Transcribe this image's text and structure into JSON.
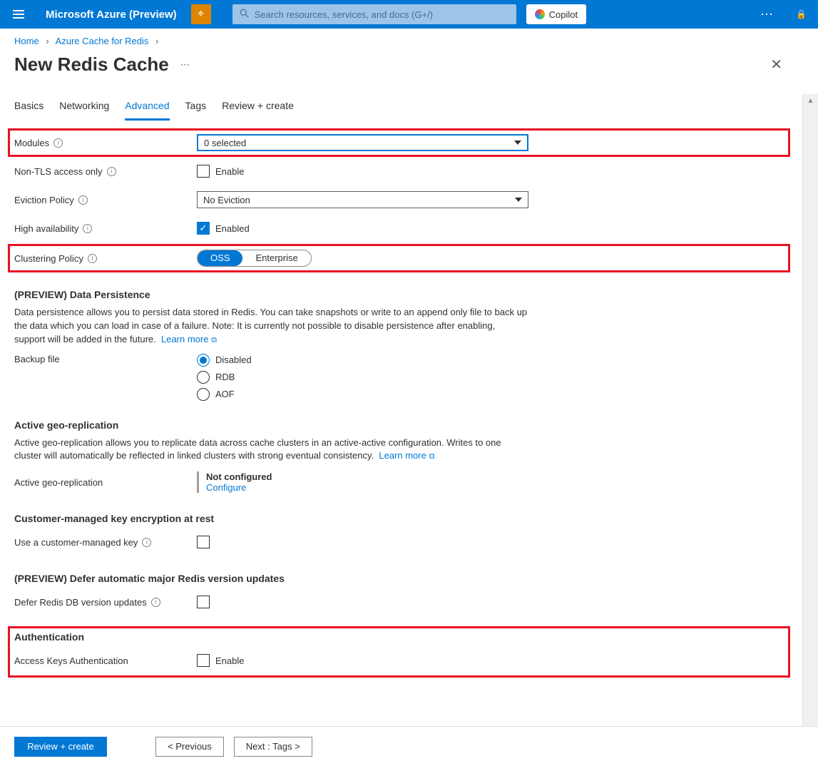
{
  "topbar": {
    "brand": "Microsoft Azure (Preview)",
    "search_placeholder": "Search resources, services, and docs (G+/)",
    "copilot": "Copilot"
  },
  "breadcrumb": {
    "home": "Home",
    "parent": "Azure Cache for Redis"
  },
  "page_title": "New Redis Cache",
  "tabs": {
    "basics": "Basics",
    "networking": "Networking",
    "advanced": "Advanced",
    "tags": "Tags",
    "review": "Review + create"
  },
  "modules": {
    "label": "Modules",
    "value": "0 selected"
  },
  "nontls": {
    "label": "Non-TLS access only",
    "cb_label": "Enable"
  },
  "eviction": {
    "label": "Eviction Policy",
    "value": "No Eviction"
  },
  "ha": {
    "label": "High availability",
    "cb_label": "Enabled"
  },
  "cluster": {
    "label": "Clustering Policy",
    "oss": "OSS",
    "ent": "Enterprise"
  },
  "persistence": {
    "title": "(PREVIEW) Data Persistence",
    "desc": "Data persistence allows you to persist data stored in Redis. You can take snapshots or write to an append only file to back up the data which you can load in case of a failure. Note: It is currently not possible to disable persistence after enabling, support will be added in the future.",
    "learn": "Learn more",
    "backup_label": "Backup file",
    "disabled": "Disabled",
    "rdb": "RDB",
    "aof": "AOF"
  },
  "geo": {
    "title": "Active geo-replication",
    "desc": "Active geo-replication allows you to replicate data across cache clusters in an active-active configuration. Writes to one cluster will automatically be reflected in linked clusters with strong eventual consistency.",
    "learn": "Learn more",
    "label": "Active geo-replication",
    "status": "Not configured",
    "configure": "Configure"
  },
  "cmk": {
    "title": "Customer-managed key encryption at rest",
    "label": "Use a customer-managed key"
  },
  "defer": {
    "title": "(PREVIEW) Defer automatic major Redis version updates",
    "label": "Defer Redis DB version updates"
  },
  "auth": {
    "title": "Authentication",
    "label": "Access Keys Authentication",
    "cb_label": "Enable"
  },
  "footer": {
    "review": "Review + create",
    "prev": "<  Previous",
    "next": "Next : Tags  >"
  }
}
